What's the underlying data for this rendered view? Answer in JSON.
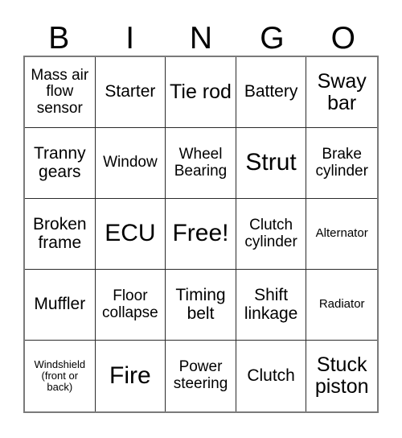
{
  "card": {
    "headers": [
      "B",
      "I",
      "N",
      "G",
      "O"
    ],
    "rows": [
      [
        {
          "text": "Mass air flow sensor",
          "size": "sm"
        },
        {
          "text": "Starter",
          "size": "md"
        },
        {
          "text": "Tie rod",
          "size": "lg"
        },
        {
          "text": "Battery",
          "size": "md"
        },
        {
          "text": "Sway bar",
          "size": "lg"
        }
      ],
      [
        {
          "text": "Tranny gears",
          "size": "md"
        },
        {
          "text": "Window",
          "size": "sm"
        },
        {
          "text": "Wheel Bearing",
          "size": "sm"
        },
        {
          "text": "Strut",
          "size": "xl"
        },
        {
          "text": "Brake cylinder",
          "size": "sm"
        }
      ],
      [
        {
          "text": "Broken frame",
          "size": "md"
        },
        {
          "text": "ECU",
          "size": "xl"
        },
        {
          "text": "Free!",
          "size": "xl"
        },
        {
          "text": "Clutch cylinder",
          "size": "sm"
        },
        {
          "text": "Alternator",
          "size": "xs"
        }
      ],
      [
        {
          "text": "Muffler",
          "size": "md"
        },
        {
          "text": "Floor collapse",
          "size": "sm"
        },
        {
          "text": "Timing belt",
          "size": "md"
        },
        {
          "text": "Shift linkage",
          "size": "md"
        },
        {
          "text": "Radiator",
          "size": "xs"
        }
      ],
      [
        {
          "text": "Windshield (front or back)",
          "size": "xxs"
        },
        {
          "text": "Fire",
          "size": "xl"
        },
        {
          "text": "Power steering",
          "size": "sm"
        },
        {
          "text": "Clutch",
          "size": "md"
        },
        {
          "text": "Stuck piston",
          "size": "lg"
        }
      ]
    ]
  }
}
